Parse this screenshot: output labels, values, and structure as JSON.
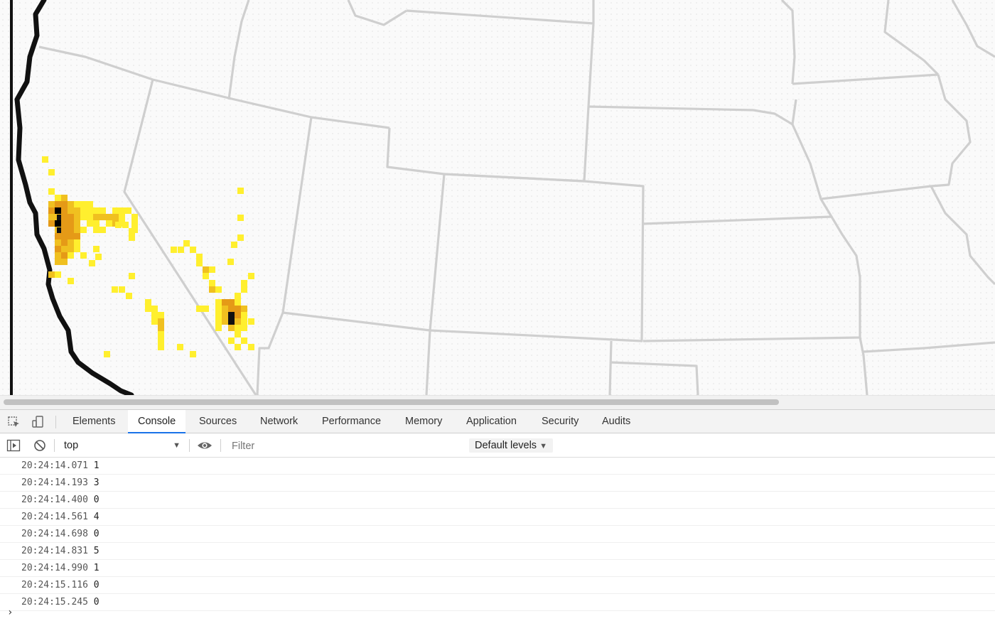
{
  "colors": {
    "accent": "#1a73e8",
    "heat_low": "#ffef2e",
    "heat_mid": "#f0c020",
    "heat_high": "#e59a17",
    "heat_max": "#111111",
    "coastline": "#111111",
    "state_border": "#cccccc"
  },
  "devtools": {
    "tabs": [
      {
        "label": "Elements"
      },
      {
        "label": "Console",
        "active": true
      },
      {
        "label": "Sources"
      },
      {
        "label": "Network"
      },
      {
        "label": "Performance"
      },
      {
        "label": "Memory"
      },
      {
        "label": "Application"
      },
      {
        "label": "Security"
      },
      {
        "label": "Audits"
      }
    ],
    "icons": {
      "inspect": "inspect-element-icon",
      "device": "device-toolbar-icon",
      "sidebar": "show-sidebar-icon",
      "clear": "clear-console-icon",
      "eye": "live-expression-icon"
    },
    "toolbar": {
      "context": "top",
      "filter_placeholder": "Filter",
      "levels": "Default levels"
    },
    "logs": [
      {
        "time": "20:24:14.071",
        "value": "1"
      },
      {
        "time": "20:24:14.193",
        "value": "3"
      },
      {
        "time": "20:24:14.400",
        "value": "0"
      },
      {
        "time": "20:24:14.561",
        "value": "4"
      },
      {
        "time": "20:24:14.698",
        "value": "0"
      },
      {
        "time": "20:24:14.831",
        "value": "5"
      },
      {
        "time": "20:24:14.990",
        "value": "1"
      },
      {
        "time": "20:24:15.116",
        "value": "0"
      },
      {
        "time": "20:24:15.245",
        "value": "0"
      }
    ],
    "prompt_symbol": "›"
  }
}
